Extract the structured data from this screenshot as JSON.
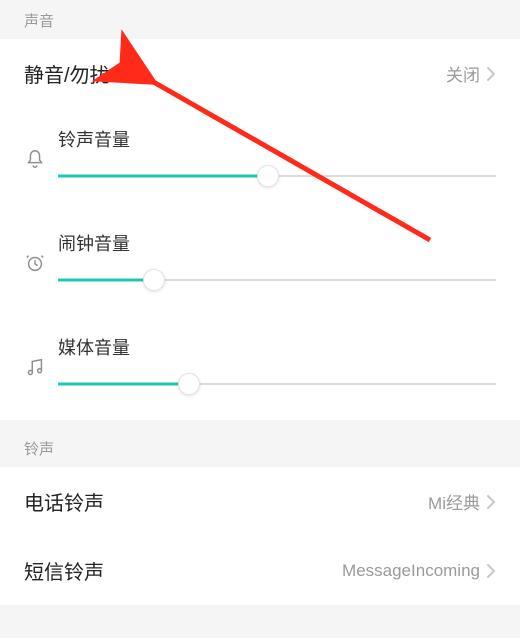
{
  "sections": {
    "sound_header": "声音",
    "ringtone_header": "铃声"
  },
  "dnd": {
    "label": "静音/勿扰",
    "value": "关闭"
  },
  "volumes": {
    "ringer": {
      "label": "铃声音量",
      "percent": 48
    },
    "alarm": {
      "label": "闹钟音量",
      "percent": 22
    },
    "media": {
      "label": "媒体音量",
      "percent": 30
    }
  },
  "ringtones": {
    "call": {
      "label": "电话铃声",
      "value": "Mi经典"
    },
    "sms": {
      "label": "短信铃声",
      "value": "MessageIncoming"
    }
  },
  "colors": {
    "accent": "#1ec8b0",
    "annotation": "#ff2a1a"
  }
}
